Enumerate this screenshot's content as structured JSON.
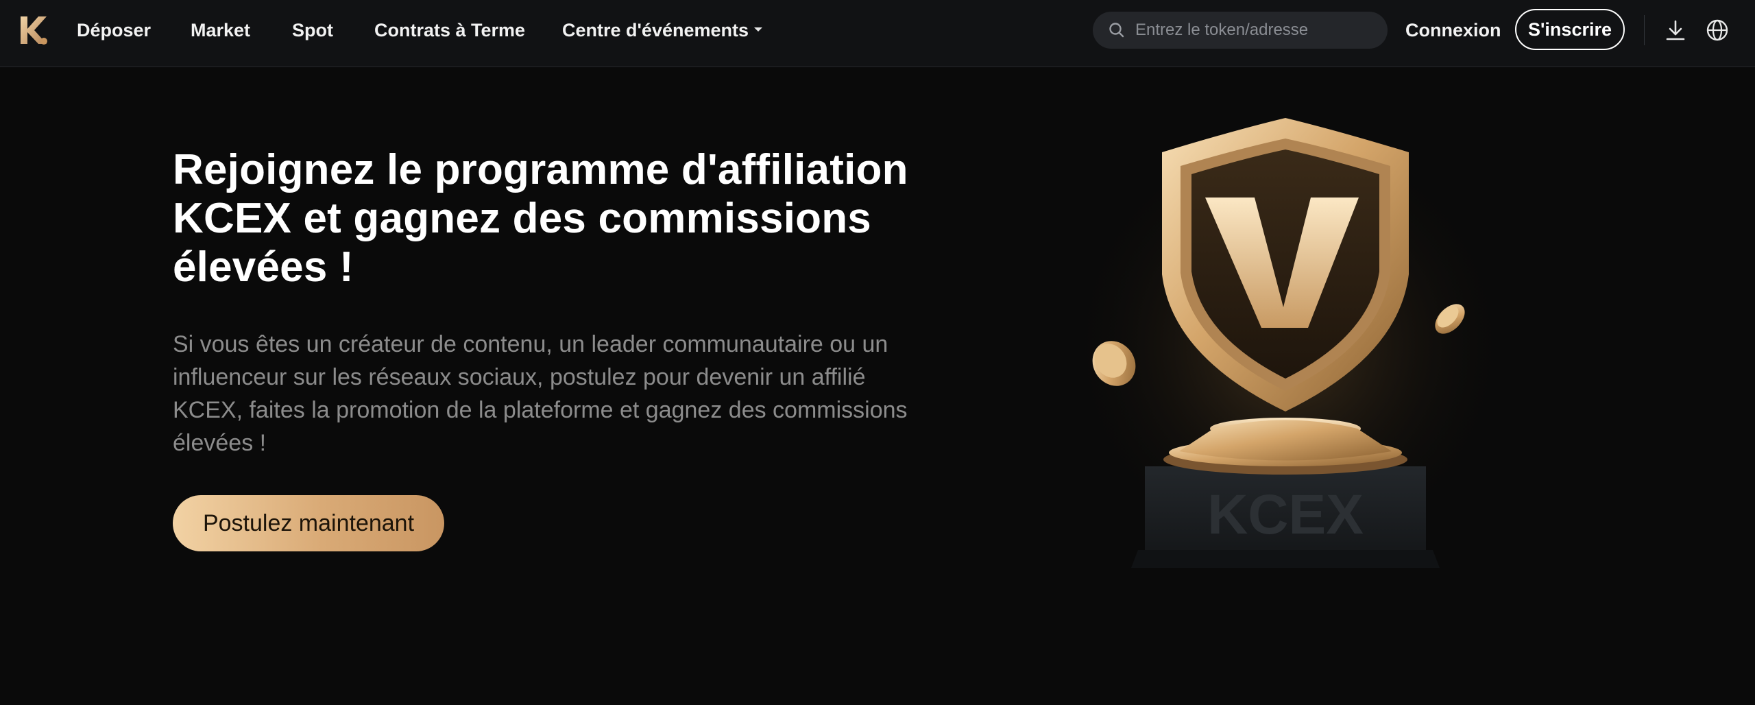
{
  "header": {
    "logo_icon": "kcex-logo-icon",
    "nav": [
      {
        "label": "Déposer"
      },
      {
        "label": "Market"
      },
      {
        "label": "Spot"
      },
      {
        "label": "Contrats à Terme"
      },
      {
        "label": "Centre d'événements",
        "has_dropdown": true
      }
    ],
    "search": {
      "placeholder": "Entrez le token/adresse",
      "value": ""
    },
    "login_label": "Connexion",
    "signup_label": "S'inscrire",
    "download_icon": "download-icon",
    "language_icon": "globe-icon"
  },
  "hero": {
    "title": "Rejoignez le programme d'affiliation KCEX et gagnez des commissions élevées !",
    "description": "Si vous êtes un créateur de contenu, un leader communautaire ou un influenceur sur les réseaux sociaux, postulez pour devenir un affilié KCEX, faites la promotion de la plateforme et gagnez des commissions élevées !",
    "cta_label": "Postulez maintenant",
    "trophy_shield_letter": "V",
    "trophy_base_text": "KCEX"
  },
  "colors": {
    "background": "#0a0a0a",
    "header_bg": "#111214",
    "accent_gold": "#d9aa76",
    "text_muted": "#8c8c8c"
  }
}
